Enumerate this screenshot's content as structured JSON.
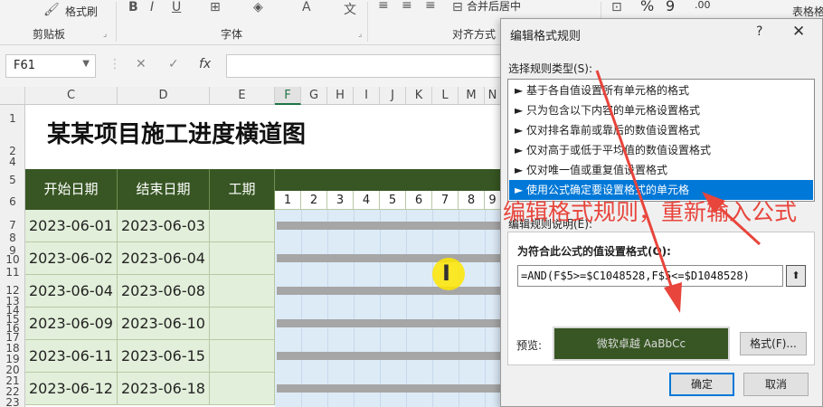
{
  "ribbon": {
    "row1": {
      "format_painter": "格式刷",
      "merge_center": "合并后居中",
      "percent": "%",
      "comma": "9",
      "inc_decimal": ".00",
      "table_format": "表格格"
    },
    "groups": {
      "clipboard": "剪贴板",
      "font": "字体",
      "alignment": "对齐方式"
    }
  },
  "formula_bar": {
    "name_box": "F61",
    "cancel": "✕",
    "confirm": "✓",
    "fx": "fx",
    "value": ""
  },
  "grid": {
    "columns": [
      "C",
      "D",
      "E",
      "F",
      "G",
      "H",
      "I",
      "J",
      "K",
      "L",
      "M",
      "N"
    ],
    "rows": [
      "1",
      "2",
      "4",
      "5",
      "6",
      "7",
      "8",
      "9",
      "10",
      "11",
      "12",
      "13",
      "14",
      "15",
      "16",
      "17",
      "18",
      "19",
      "20",
      "21",
      "22",
      "23"
    ],
    "title": "某某项目施工进度横道图",
    "headers": {
      "start": "开始日期",
      "end": "结束日期",
      "duration": "工期"
    },
    "day_numbers": [
      "1",
      "2",
      "3",
      "4",
      "5",
      "6",
      "7",
      "8",
      "9"
    ],
    "tasks": [
      {
        "start": "2023-06-01",
        "end": "2023-06-03"
      },
      {
        "start": "2023-06-02",
        "end": "2023-06-04"
      },
      {
        "start": "2023-06-04",
        "end": "2023-06-08"
      },
      {
        "start": "2023-06-09",
        "end": "2023-06-10"
      },
      {
        "start": "2023-06-11",
        "end": "2023-06-15"
      },
      {
        "start": "2023-06-12",
        "end": "2023-06-18"
      }
    ],
    "cursor": "I"
  },
  "dialog": {
    "title": "编辑格式规则",
    "help": "?",
    "close": "✕",
    "select_rule_type_label": "选择规则类型(S):",
    "rule_types": [
      "► 基于各自值设置所有单元格的格式",
      "► 只为包含以下内容的单元格设置格式",
      "► 仅对排名靠前或靠后的数值设置格式",
      "► 仅对高于或低于平均值的数值设置格式",
      "► 仅对唯一值或重复值设置格式",
      "► 使用公式确定要设置格式的单元格"
    ],
    "selected_rule_index": 5,
    "edit_description_label": "编辑规则说明(E):",
    "formula_label": "为符合此公式的值设置格式(O):",
    "formula": "=AND(F$5>=$C1048528,F$5<=$D1048528)",
    "collapse_icon": "⬆",
    "preview_label": "预览:",
    "preview_text": "微软卓越  AaBbCc",
    "format_button": "格式(F)...",
    "ok_button": "确定",
    "cancel_button": "取消"
  },
  "annotation": {
    "text": "编辑格式规则，重新输入公式"
  },
  "colors": {
    "header_green": "#375623",
    "cell_green": "#e2efda",
    "gantt_blue": "#ddebf7",
    "bar_gray": "#a6a6a6",
    "selection_blue": "#0078d7",
    "annotation_red": "#e8453c"
  }
}
